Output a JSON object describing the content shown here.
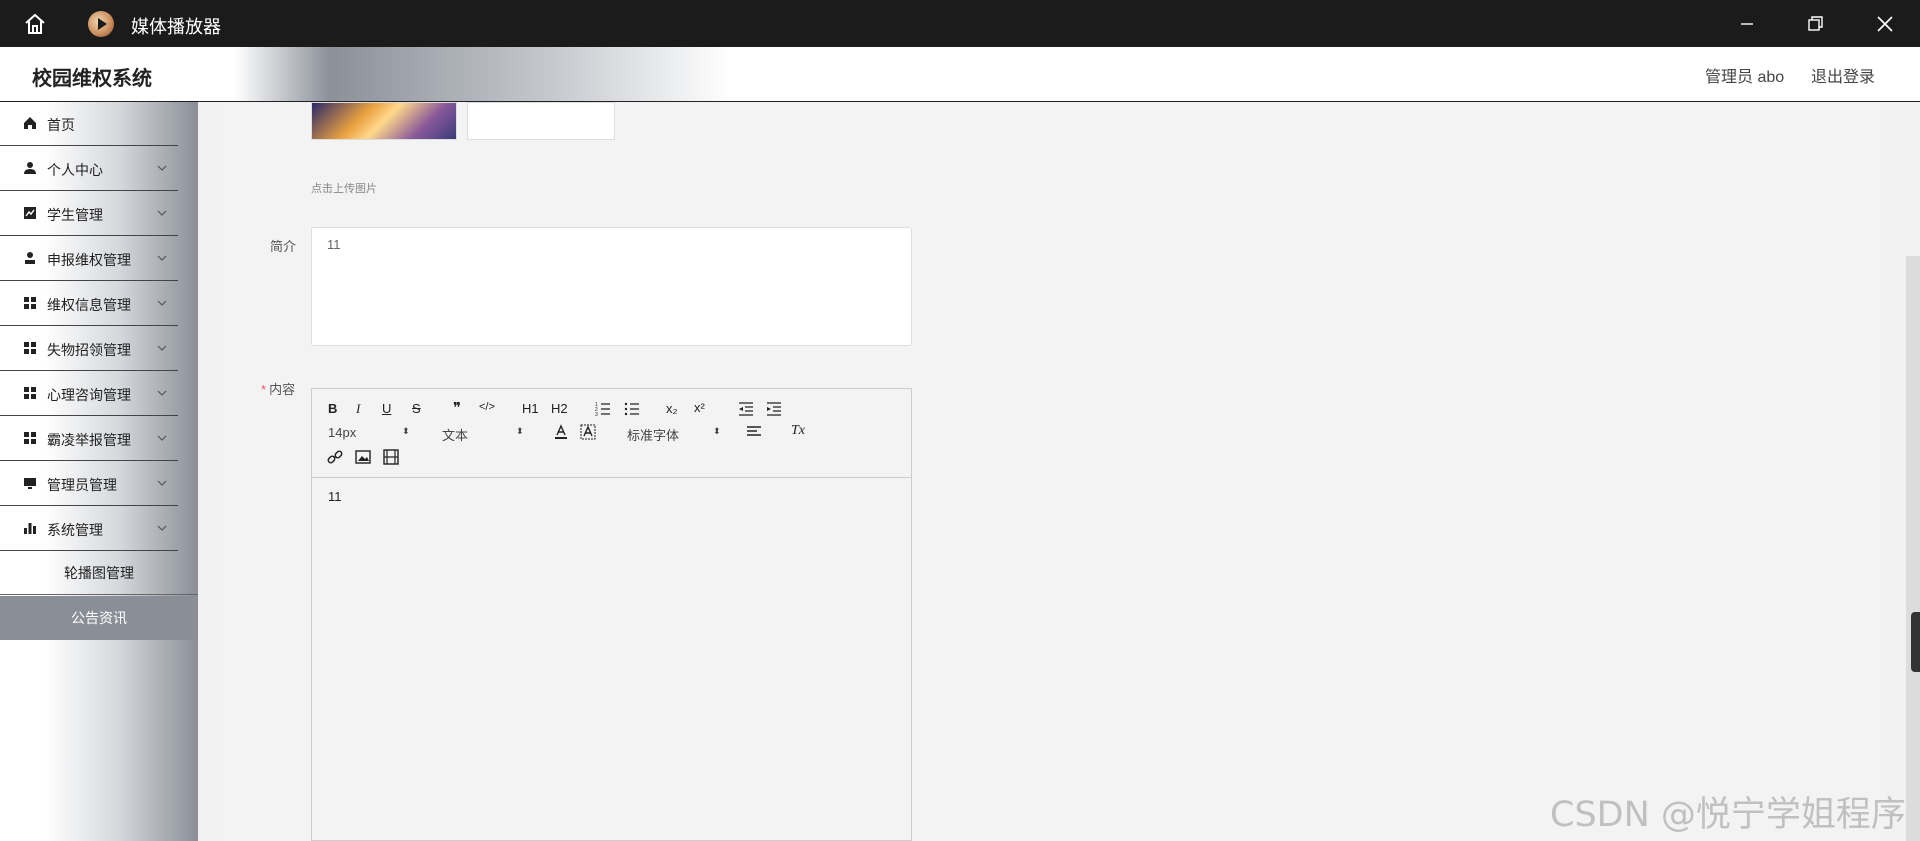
{
  "window": {
    "title": "媒体播放器"
  },
  "header": {
    "brand": "校园维权系统",
    "admin_label": "管理员 abo",
    "logout_label": "退出登录"
  },
  "sidebar": {
    "items": [
      {
        "label": "首页",
        "icon": "home-icon"
      },
      {
        "label": "个人中心",
        "icon": "user-icon"
      },
      {
        "label": "学生管理",
        "icon": "chart-icon"
      },
      {
        "label": "申报维权管理",
        "icon": "person-icon"
      },
      {
        "label": "维权信息管理",
        "icon": "grid-icon"
      },
      {
        "label": "失物招领管理",
        "icon": "grid-icon"
      },
      {
        "label": "心理咨询管理",
        "icon": "grid-icon"
      },
      {
        "label": "霸凌举报管理",
        "icon": "grid-icon"
      },
      {
        "label": "管理员管理",
        "icon": "monitor-icon"
      },
      {
        "label": "系统管理",
        "icon": "bar-chart-icon"
      }
    ],
    "sub_items": [
      "轮播图管理",
      "公告资讯"
    ]
  },
  "form": {
    "upload_hint": "点击上传图片",
    "intro_label": "简介",
    "intro_value": "11",
    "content_label": "内容",
    "content_required_mark": "*",
    "content_value": "11"
  },
  "editor_toolbar": {
    "bold": "B",
    "italic": "I",
    "underline": "U",
    "strike": "S",
    "quote": "❞",
    "code": "</>",
    "h1": "H1",
    "h2": "H2",
    "subscript": "x₂",
    "superscript": "x²",
    "size_picker": "14px",
    "header_picker": "文本",
    "font_picker": "标准字体",
    "clean": "Tx"
  },
  "watermark": "CSDN @悦宁学姐程序",
  "colors": {
    "titlebar_bg": "#1b1b1b",
    "selected_item_bg": "#8a8f97",
    "required": "#e56"
  }
}
